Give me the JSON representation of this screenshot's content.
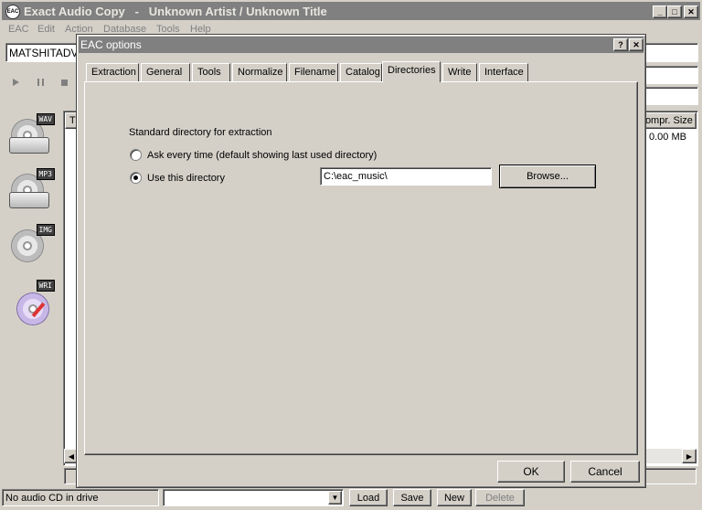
{
  "window": {
    "title": "Exact Audio Copy   -   Unknown Artist / Unknown Title",
    "app_icon_text": "EAC",
    "minimize": "_",
    "maximize": "□",
    "close": "✕"
  },
  "menu": [
    "EAC",
    "Edit",
    "Action",
    "Database",
    "Tools",
    "Help"
  ],
  "drive_select": {
    "value": "MATSHITADVD"
  },
  "side_tools": [
    {
      "tag": "WAV",
      "icon": "wav-disc-icon"
    },
    {
      "tag": "MP3",
      "icon": "mp3-disc-icon"
    },
    {
      "tag": "IMG",
      "icon": "img-disc-icon"
    },
    {
      "tag": "WRI",
      "icon": "write-disc-icon"
    }
  ],
  "track_list": {
    "col_first": "T",
    "col_compr_size": "Compr. Size",
    "row_size": "0.00 MB"
  },
  "dialog": {
    "title": "EAC options",
    "help": "?",
    "close": "✕",
    "tabs": [
      "Extraction",
      "General",
      "Tools",
      "Normalize",
      "Filename",
      "Catalog",
      "Directories",
      "Write",
      "Interface"
    ],
    "active_tab": "Directories",
    "group_label": "Standard directory for extraction",
    "option_ask": "Ask every time (default showing last used directory)",
    "option_use": "Use this directory",
    "selected_option": "use",
    "directory_value": "C:\\eac_music\\",
    "browse_label": "Browse...",
    "ok_label": "OK",
    "cancel_label": "Cancel"
  },
  "statusbar": {
    "status_text": "No audio CD in drive",
    "load": "Load",
    "save": "Save",
    "new": "New",
    "delete": "Delete"
  }
}
